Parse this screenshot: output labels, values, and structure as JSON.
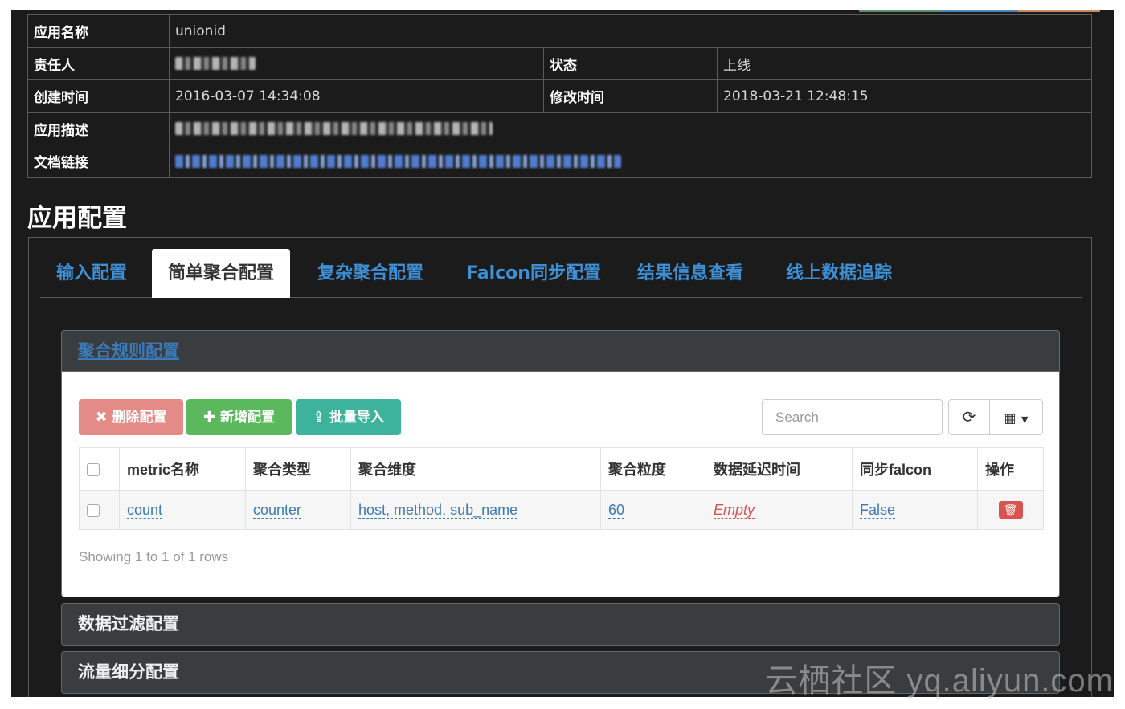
{
  "info": {
    "app_name_label": "应用名称",
    "app_name": "unionid",
    "owner_label": "责任人",
    "status_label": "状态",
    "status": "上线",
    "created_label": "创建时间",
    "created": "2016-03-07 14:34:08",
    "modified_label": "修改时间",
    "modified": "2018-03-21 12:48:15",
    "desc_label": "应用描述",
    "doc_label": "文档链接"
  },
  "section_title": "应用配置",
  "tabs": [
    {
      "label": "输入配置"
    },
    {
      "label": "简单聚合配置"
    },
    {
      "label": "复杂聚合配置"
    },
    {
      "label": "Falcon同步配置"
    },
    {
      "label": "结果信息查看"
    },
    {
      "label": "线上数据追踪"
    }
  ],
  "card": {
    "title": "聚合规则配置",
    "buttons": {
      "delete": "删除配置",
      "add": "新增配置",
      "import": "批量导入"
    },
    "search_placeholder": "Search",
    "columns": [
      "metric名称",
      "聚合类型",
      "聚合维度",
      "聚合粒度",
      "数据延迟时间",
      "同步falcon",
      "操作"
    ],
    "rows": [
      {
        "metric": "count",
        "type": "counter",
        "dims": "host, method, sub_name",
        "granularity": "60",
        "delay": "Empty",
        "sync": "False"
      }
    ],
    "footer": "Showing 1 to 1 of 1 rows"
  },
  "accordions": {
    "filter": "数据过滤配置",
    "split": "流量细分配置"
  },
  "watermark": "云栖社区 yq.aliyun.com"
}
